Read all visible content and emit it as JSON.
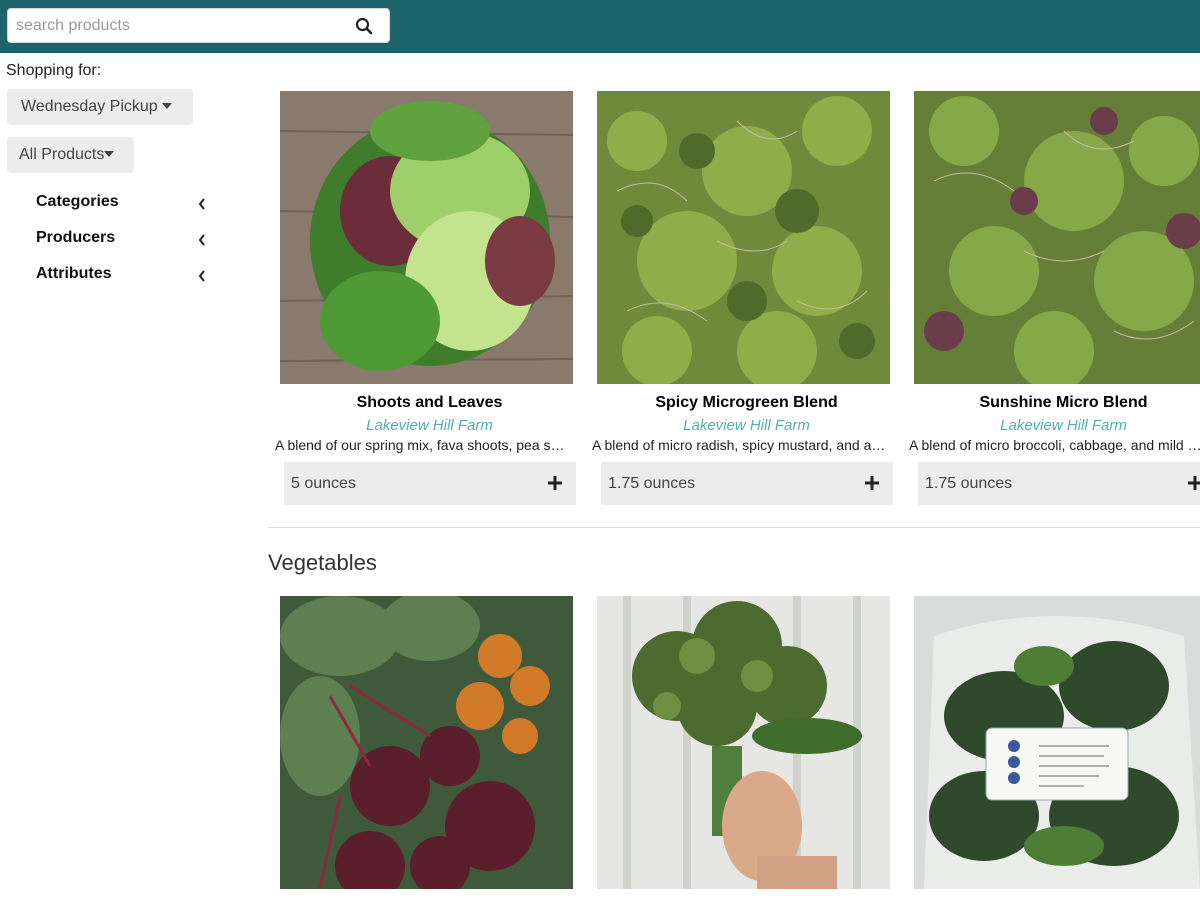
{
  "search": {
    "placeholder": "search products"
  },
  "sidebar": {
    "shopping_for_label": "Shopping for:",
    "pickup_dropdown": "Wednesday Pickup",
    "products_dropdown": "All Products",
    "filters": [
      {
        "label": "Categories"
      },
      {
        "label": "Producers"
      },
      {
        "label": "Attributes"
      }
    ]
  },
  "products": [
    {
      "name": "Shoots and Leaves",
      "farm": "Lakeview Hill Farm",
      "description": "A blend of our spring mix, fava shoots, pea shoots and more",
      "quantity": "5 ounces",
      "image": "salad-greens"
    },
    {
      "name": "Spicy Microgreen Blend",
      "farm": "Lakeview Hill Farm",
      "description": "A blend of micro radish, spicy mustard, and arugula",
      "quantity": "1.75 ounces",
      "image": "microgreens"
    },
    {
      "name": "Sunshine Micro Blend",
      "farm": "Lakeview Hill Farm",
      "description": "A blend of micro broccoli, cabbage, and mild greens",
      "quantity": "1.75 ounces",
      "image": "microgreens"
    }
  ],
  "sections": [
    {
      "title": "Vegetables",
      "items": [
        {
          "image": "beets"
        },
        {
          "image": "broccolini"
        },
        {
          "image": "baby-bok-choi-bag"
        }
      ]
    }
  ],
  "colors": {
    "topbar": "#1e646c",
    "farm_link": "#4fb0b0",
    "button_bg": "#ececec"
  }
}
